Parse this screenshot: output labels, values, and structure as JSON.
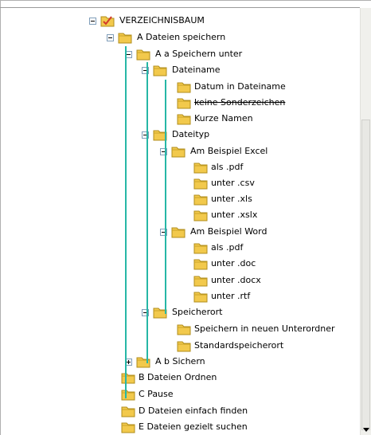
{
  "tree": {
    "root": "VERZEICHNISBAUM",
    "a": "A Dateien speichern",
    "aa": "A a Speichern unter",
    "dateiname": "Dateiname",
    "datum": "Datum in Dateiname",
    "keine": "keine Sonderzeichen",
    "kurze": "Kurze Namen",
    "dateityp": "Dateityp",
    "excel": "Am Beispiel Excel",
    "ex_pdf": "als .pdf",
    "ex_csv": "unter .csv",
    "ex_xls": "unter .xls",
    "ex_xslx": "unter .xslx",
    "word": "Am Beispiel Word",
    "wd_pdf": "als .pdf",
    "wd_doc": "unter .doc",
    "wd_docx": "unter .docx",
    "wd_rtf": "unter .rtf",
    "speicherort": "Speicherort",
    "unterordner": "Speichern in neuen Unterordner",
    "standard": "Standardspeicherort",
    "ab": "A b Sichern",
    "b": "B Dateien Ordnen",
    "c": "C Pause",
    "d": "D Dateien einfach finden",
    "e": "E Dateien gezielt suchen"
  },
  "colors": {
    "connector": "#26b7a6",
    "folder": "#f2c94c",
    "check": "#d23a2a"
  }
}
